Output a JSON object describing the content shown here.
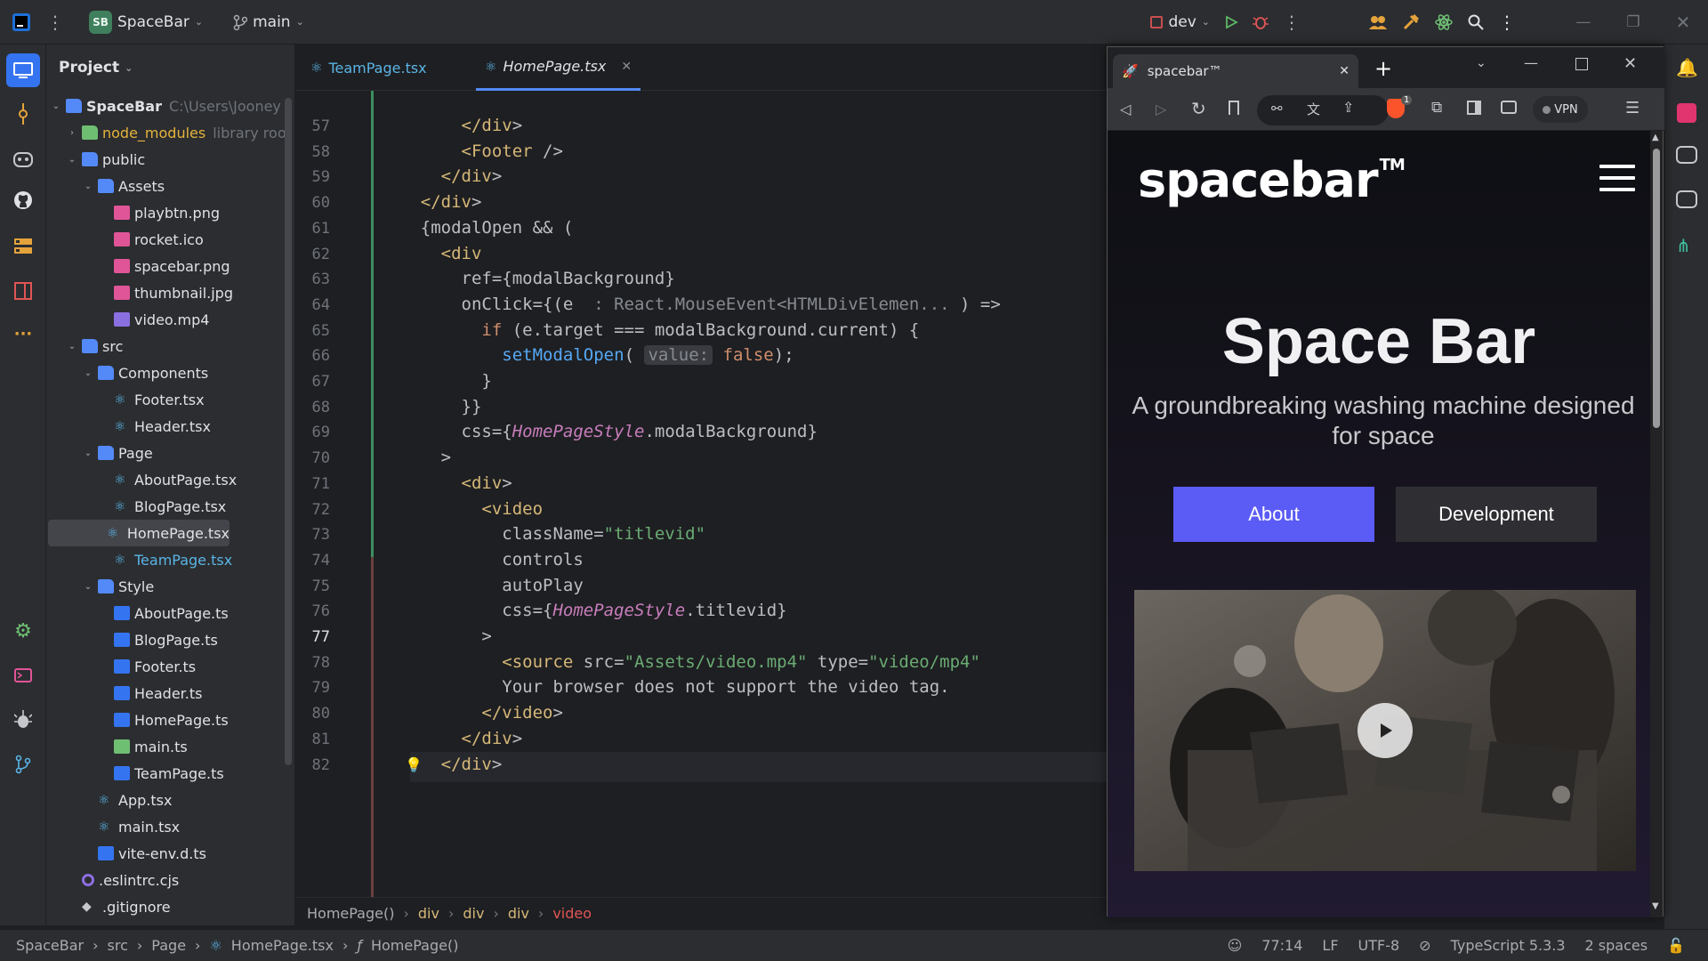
{
  "topbar": {
    "project_badge": "SB",
    "project_name": "SpaceBar",
    "branch": "main",
    "run_config": "dev"
  },
  "project_panel": {
    "title": "Project",
    "tree": [
      {
        "label": "SpaceBar",
        "hint": "C:\\Users\\Jooney",
        "type": "root"
      },
      {
        "label": "node_modules",
        "hint": "library roo",
        "type": "folder-lib"
      },
      {
        "label": "public",
        "type": "folder"
      },
      {
        "label": "Assets",
        "type": "folder"
      },
      {
        "label": "playbtn.png",
        "type": "image"
      },
      {
        "label": "rocket.ico",
        "type": "image"
      },
      {
        "label": "spacebar.png",
        "type": "image"
      },
      {
        "label": "thumbnail.jpg",
        "type": "image"
      },
      {
        "label": "video.mp4",
        "type": "video"
      },
      {
        "label": "src",
        "type": "folder"
      },
      {
        "label": "Components",
        "type": "folder"
      },
      {
        "label": "Footer.tsx",
        "type": "react"
      },
      {
        "label": "Header.tsx",
        "type": "react"
      },
      {
        "label": "Page",
        "type": "folder"
      },
      {
        "label": "AboutPage.tsx",
        "type": "react"
      },
      {
        "label": "BlogPage.tsx",
        "type": "react"
      },
      {
        "label": "HomePage.tsx",
        "type": "react"
      },
      {
        "label": "TeamPage.tsx",
        "type": "react"
      },
      {
        "label": "Style",
        "type": "folder"
      },
      {
        "label": "AboutPage.ts",
        "type": "ts"
      },
      {
        "label": "BlogPage.ts",
        "type": "ts"
      },
      {
        "label": "Footer.ts",
        "type": "ts"
      },
      {
        "label": "Header.ts",
        "type": "ts"
      },
      {
        "label": "HomePage.ts",
        "type": "ts"
      },
      {
        "label": "main.ts",
        "type": "ts-green"
      },
      {
        "label": "TeamPage.ts",
        "type": "ts"
      },
      {
        "label": "App.tsx",
        "type": "react"
      },
      {
        "label": "main.tsx",
        "type": "react"
      },
      {
        "label": "vite-env.d.ts",
        "type": "ts"
      },
      {
        "label": ".eslintrc.cjs",
        "type": "eslint"
      },
      {
        "label": ".gitignore",
        "type": "git"
      }
    ]
  },
  "editor": {
    "tabs": [
      {
        "label": "TeamPage.tsx",
        "active": false
      },
      {
        "label": "HomePage.tsx",
        "active": true
      }
    ],
    "line_numbers": [
      "57",
      "58",
      "59",
      "60",
      "61",
      "62",
      "63",
      "64",
      "65",
      "66",
      "67",
      "68",
      "69",
      "70",
      "71",
      "72",
      "73",
      "74",
      "75",
      "76",
      "77",
      "78",
      "79",
      "80",
      "81",
      "82"
    ],
    "lines": [
      "        </div>",
      "        <Footer />",
      "      </div>",
      "    </div>",
      "    {modalOpen && (",
      "      <div",
      "        ref={modalBackground}",
      "        onClick={(e : React.MouseEvent<HTMLDivElemen... ) =>",
      "          if (e.target === modalBackground.current) {",
      "            setModalOpen( value: false);",
      "          }",
      "        }}",
      "        css={HomePageStyle.modalBackground}",
      "      >",
      "        <div>",
      "          <video",
      "            className=\"titlevid\"",
      "            controls",
      "            autoPlay",
      "            css={HomePageStyle.titlevid}",
      "          >",
      "            <source src=\"Assets/video.mp4\" type=\"video/mp4\"",
      "            Your browser does not support the video tag.",
      "          </video>",
      "        </div>",
      "      </div>"
    ],
    "breadcrumbs": [
      "HomePage()",
      "div",
      "div",
      "div",
      "video"
    ]
  },
  "statusbar": {
    "path": [
      "SpaceBar",
      "src",
      "Page",
      "HomePage.tsx",
      "HomePage()"
    ],
    "position": "77:14",
    "line_sep": "LF",
    "encoding": "UTF-8",
    "language": "TypeScript 5.3.3",
    "indent": "2 spaces"
  },
  "browser": {
    "tab_title": "spacebar™",
    "vpn_label": "VPN",
    "brave_badge": "1",
    "page": {
      "logo": "spacebar",
      "logo_tm": "TM",
      "title": "Space Bar",
      "subtitle": "A groundbreaking washing machine designed for space",
      "about_button": "About",
      "dev_button": "Development"
    }
  },
  "colors": {
    "accent": "#5b5bf6",
    "ide_bg": "#1e1f22",
    "panel_bg": "#2b2d30"
  }
}
